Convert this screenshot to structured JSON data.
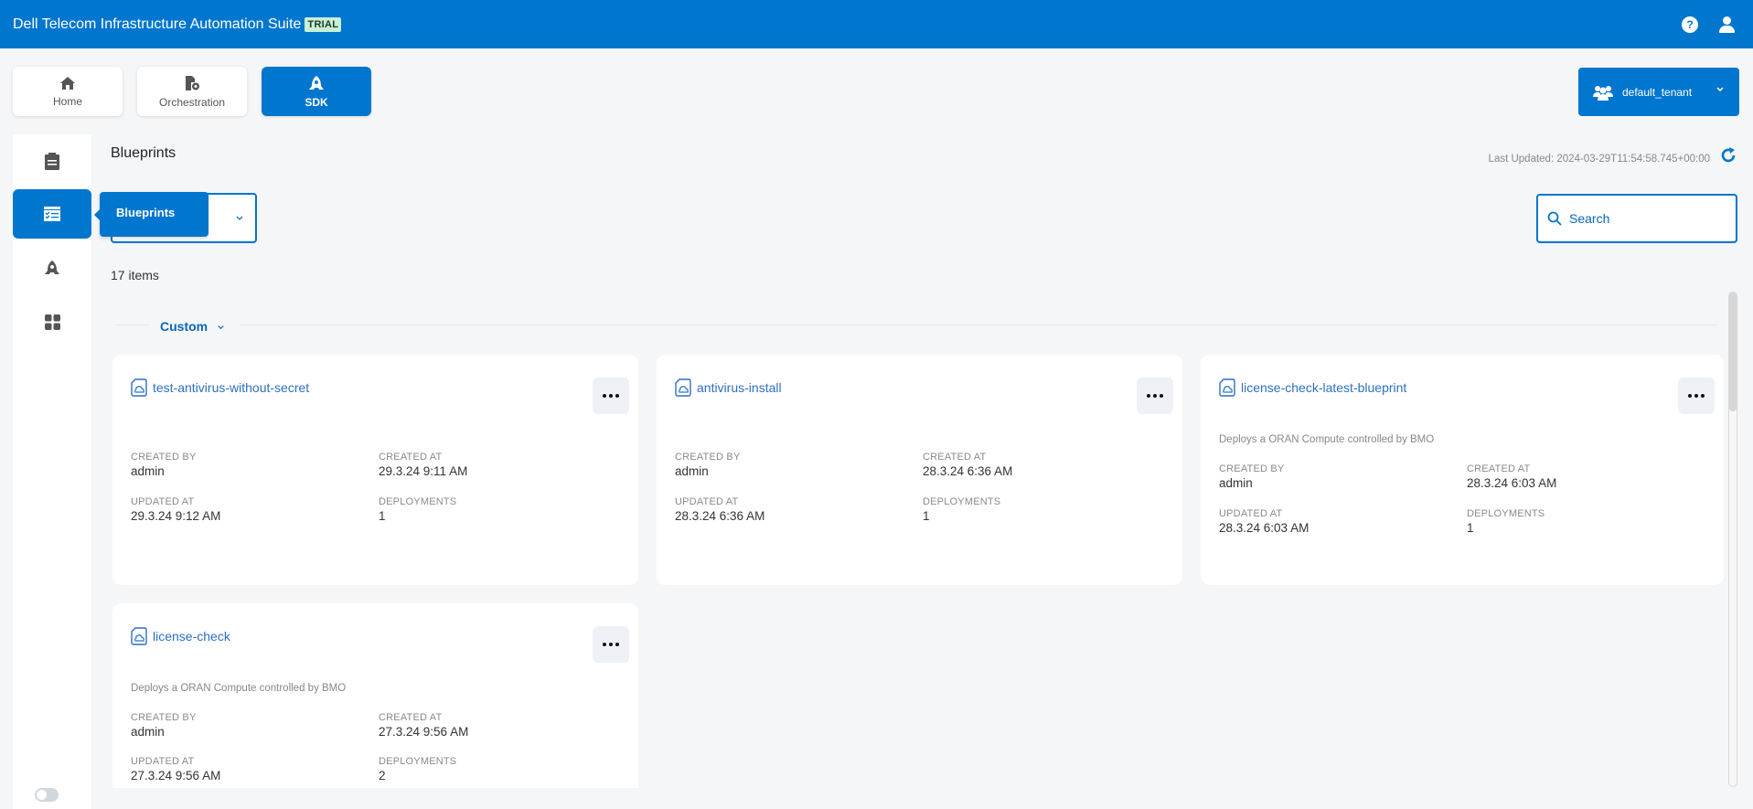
{
  "header": {
    "app_title": "Dell Telecom Infrastructure Automation Suite",
    "badge": "TRIAL",
    "icons": [
      "help-icon",
      "user-icon"
    ]
  },
  "modules": [
    {
      "label": "Home",
      "icon": "home-icon",
      "active": false
    },
    {
      "label": "Orchestration",
      "icon": "orchestration-icon",
      "active": false
    },
    {
      "label": "SDK",
      "icon": "rocket-icon",
      "active": true
    }
  ],
  "tenant": {
    "name": "default_tenant",
    "icon": "users-icon"
  },
  "sidebar": {
    "items": [
      {
        "name": "clipboard-icon",
        "active": false
      },
      {
        "name": "blueprints-icon",
        "active": true,
        "tooltip": "Blueprints"
      },
      {
        "name": "rocket-icon",
        "active": false
      },
      {
        "name": "apps-grid-icon",
        "active": false
      }
    ],
    "toggle_on": false
  },
  "main": {
    "title": "Blueprints",
    "last_updated": "Last Updated: 2024-03-29T11:54:58.745+00:00",
    "search_placeholder": "Search",
    "filter_value": "",
    "items_count": "17 items",
    "group_label": "Custom"
  },
  "labels": {
    "created_by": "CREATED BY",
    "created_at": "CREATED AT",
    "updated_at": "UPDATED AT",
    "deployments": "DEPLOYMENTS"
  },
  "blueprints": [
    {
      "name": "test-antivirus-without-secret",
      "description": "",
      "created_by": "admin",
      "created_at": "29.3.24 9:11 AM",
      "updated_at": "29.3.24 9:12 AM",
      "deployments": "1"
    },
    {
      "name": "antivirus-install",
      "description": "",
      "created_by": "admin",
      "created_at": "28.3.24 6:36 AM",
      "updated_at": "28.3.24 6:36 AM",
      "deployments": "1"
    },
    {
      "name": "license-check-latest-blueprint",
      "description": "Deploys a ORAN Compute controlled by BMO",
      "created_by": "admin",
      "created_at": "28.3.24 6:03 AM",
      "updated_at": "28.3.24 6:03 AM",
      "deployments": "1"
    },
    {
      "name": "license-check",
      "description": "Deploys a ORAN Compute controlled by BMO",
      "created_by": "admin",
      "created_at": "27.3.24 9:56 AM",
      "updated_at": "27.3.24 9:56 AM",
      "deployments": "2"
    }
  ]
}
